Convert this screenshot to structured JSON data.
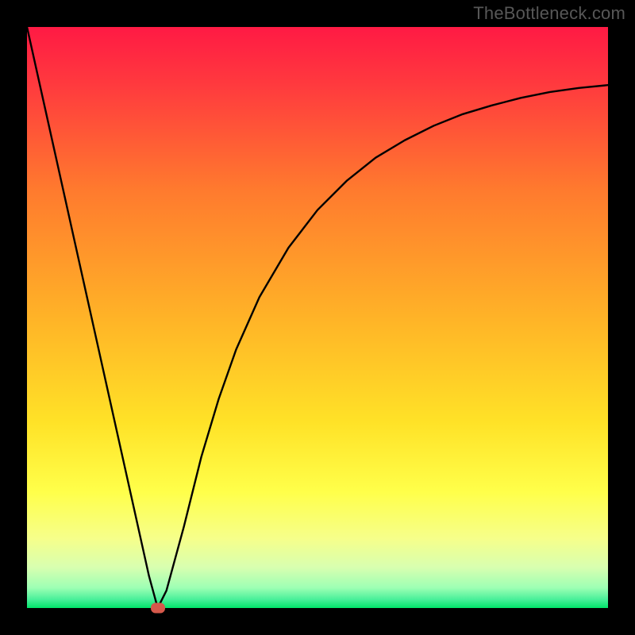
{
  "watermark": "TheBottleneck.com",
  "chart_data": {
    "type": "line",
    "title": "",
    "xlabel": "",
    "ylabel": "",
    "xlim": [
      0,
      100
    ],
    "ylim": [
      0,
      100
    ],
    "grid": false,
    "background_gradient": {
      "top": "#ff1a44",
      "mid1": "#ff7a2e",
      "mid2": "#ffd427",
      "mid3": "#ffff4a",
      "mid4": "#e8ffb0",
      "bottom": "#00e56a"
    },
    "series": [
      {
        "name": "bottleneck-curve",
        "color": "#000000",
        "x": [
          0,
          3,
          6,
          9,
          12,
          15,
          18,
          21,
          22.5,
          24,
          27,
          30,
          33,
          36,
          40,
          45,
          50,
          55,
          60,
          65,
          70,
          75,
          80,
          85,
          90,
          95,
          100
        ],
        "y": [
          100,
          86.5,
          73,
          59.5,
          46,
          32.5,
          19,
          5.5,
          0,
          3,
          14,
          26,
          36,
          44.5,
          53.5,
          62,
          68.5,
          73.5,
          77.5,
          80.5,
          83,
          85,
          86.5,
          87.8,
          88.8,
          89.5,
          90
        ]
      }
    ],
    "marker": {
      "name": "target-point",
      "color": "#d6594b",
      "x": 22.5,
      "y": 0
    }
  }
}
